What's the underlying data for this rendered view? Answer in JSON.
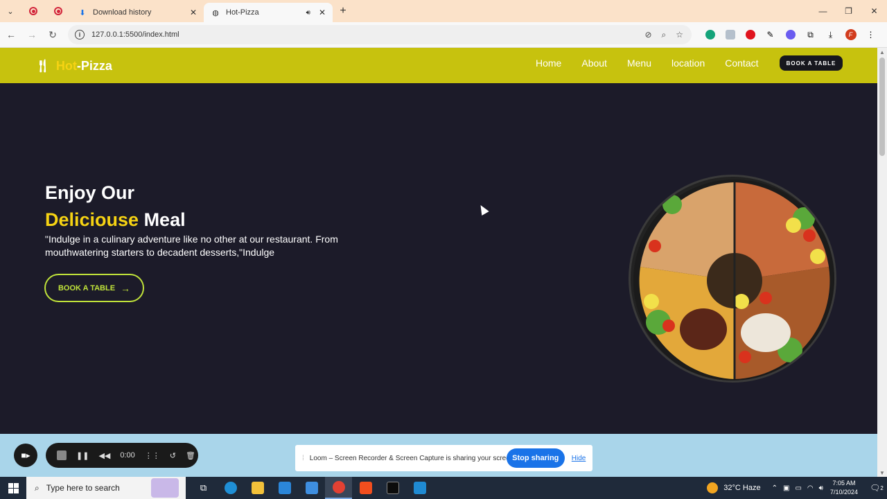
{
  "browser": {
    "tabs": [
      {
        "title": "Download history",
        "active": false
      },
      {
        "title": "Hot-Pizza",
        "active": true
      }
    ],
    "url": "127.0.0.1:5500/index.html",
    "profile_initial": "F"
  },
  "site": {
    "logo": {
      "part1": "Hot",
      "part2": "-Pizza"
    },
    "nav": [
      "Home",
      "About",
      "Menu",
      "location",
      "Contact"
    ],
    "header_cta": "BOOK A TABLE",
    "hero": {
      "line1": "Enjoy Our",
      "highlight": "Deliciouse",
      "line2_rest": " Meal",
      "description": "\"Indulge in a culinary adventure like no other at our restaurant. From mouthwatering starters to decadent desserts,\"Indulge",
      "cta": "BOOK A TABLE"
    },
    "colors": {
      "header": "#c7c20e",
      "background": "#1c1b29",
      "highlight": "#f6d313",
      "cta": "#c0e33a"
    }
  },
  "loom": {
    "timer": "0:00",
    "share_message": "Loom – Screen Recorder & Screen Capture is sharing your screen.",
    "stop_label": "Stop sharing",
    "hide_label": "Hide"
  },
  "taskbar": {
    "search_placeholder": "Type here to search",
    "weather": "32°C  Haze",
    "time": "7:05 AM",
    "date": "7/10/2024",
    "notifications": "2"
  }
}
